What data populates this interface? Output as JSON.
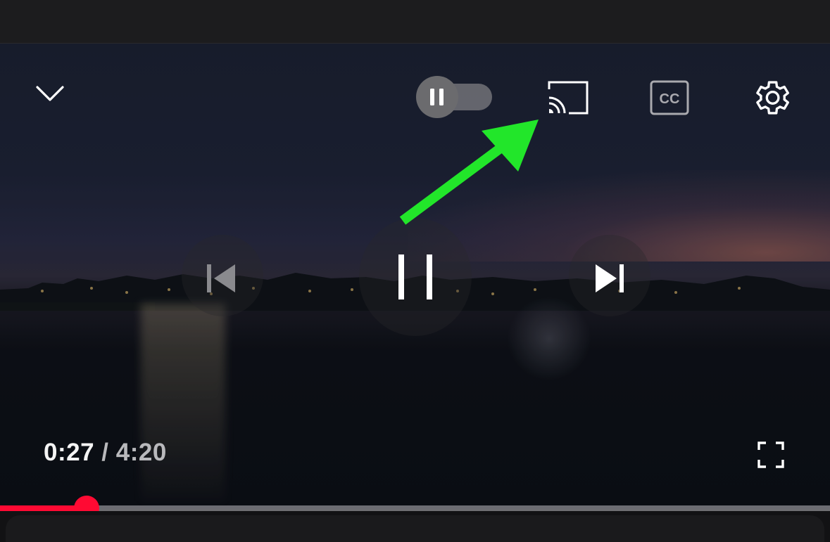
{
  "player": {
    "current_time": "0:27",
    "separator": "/",
    "duration": "4:20",
    "progress_fraction": 0.104,
    "accent_color": "#ff0a33"
  },
  "top_controls": {
    "minimize": "chevron-down-icon",
    "autoplay": {
      "state": "on",
      "icon": "pause-icon"
    },
    "cast": "cast-icon",
    "captions": "cc-icon",
    "settings": "gear-icon"
  },
  "center_controls": {
    "previous": "skip-previous-icon",
    "play_pause": "pause-icon",
    "next": "skip-next-icon"
  },
  "bottom_controls": {
    "fullscreen": "fullscreen-icon"
  },
  "annotation": {
    "arrow_color": "#22e62a",
    "points_to": "cast-icon"
  }
}
